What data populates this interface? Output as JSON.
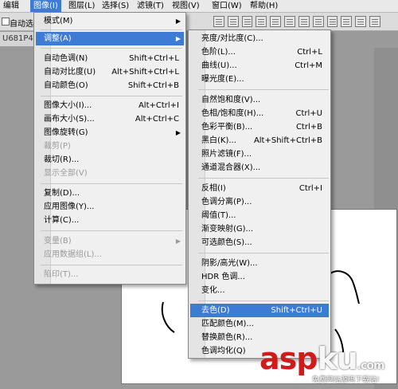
{
  "menubar": {
    "items": [
      "编辑",
      "图像(I)",
      "图层(L)",
      "选择(S)",
      "滤镜(T)",
      "视图(V)",
      "窗口(W)",
      "帮助(H)"
    ]
  },
  "options_bar": {
    "auto_select_label": "自动选"
  },
  "doc_tab": {
    "label": "U681P4"
  },
  "image_menu": {
    "items": [
      {
        "label": "模式(M)",
        "shortcut": "",
        "submenu": true,
        "state": "normal"
      },
      {
        "label": "调整(A)",
        "shortcut": "",
        "submenu": true,
        "state": "highlighted"
      },
      {
        "label": "自动色调(N)",
        "shortcut": "Shift+Ctrl+L",
        "submenu": false,
        "state": "normal"
      },
      {
        "label": "自动对比度(U)",
        "shortcut": "Alt+Shift+Ctrl+L",
        "submenu": false,
        "state": "normal"
      },
      {
        "label": "自动颜色(O)",
        "shortcut": "Shift+Ctrl+B",
        "submenu": false,
        "state": "normal"
      },
      {
        "label": "图像大小(I)...",
        "shortcut": "Alt+Ctrl+I",
        "submenu": false,
        "state": "normal"
      },
      {
        "label": "画布大小(S)...",
        "shortcut": "Alt+Ctrl+C",
        "submenu": false,
        "state": "normal"
      },
      {
        "label": "图像旋转(G)",
        "shortcut": "",
        "submenu": true,
        "state": "normal"
      },
      {
        "label": "裁剪(P)",
        "shortcut": "",
        "submenu": false,
        "state": "disabled"
      },
      {
        "label": "裁切(R)...",
        "shortcut": "",
        "submenu": false,
        "state": "normal"
      },
      {
        "label": "显示全部(V)",
        "shortcut": "",
        "submenu": false,
        "state": "disabled"
      },
      {
        "label": "复制(D)...",
        "shortcut": "",
        "submenu": false,
        "state": "normal"
      },
      {
        "label": "应用图像(Y)...",
        "shortcut": "",
        "submenu": false,
        "state": "normal"
      },
      {
        "label": "计算(C)...",
        "shortcut": "",
        "submenu": false,
        "state": "normal"
      },
      {
        "label": "变量(B)",
        "shortcut": "",
        "submenu": true,
        "state": "disabled"
      },
      {
        "label": "应用数据组(L)...",
        "shortcut": "",
        "submenu": false,
        "state": "disabled"
      },
      {
        "label": "陷印(T)...",
        "shortcut": "",
        "submenu": false,
        "state": "disabled"
      }
    ]
  },
  "adjust_menu": {
    "items": [
      {
        "label": "亮度/对比度(C)...",
        "shortcut": "",
        "state": "normal"
      },
      {
        "label": "色阶(L)...",
        "shortcut": "Ctrl+L",
        "state": "normal"
      },
      {
        "label": "曲线(U)...",
        "shortcut": "Ctrl+M",
        "state": "normal"
      },
      {
        "label": "曝光度(E)...",
        "shortcut": "",
        "state": "normal"
      },
      {
        "label": "自然饱和度(V)...",
        "shortcut": "",
        "state": "normal"
      },
      {
        "label": "色相/饱和度(H)...",
        "shortcut": "Ctrl+U",
        "state": "normal"
      },
      {
        "label": "色彩平衡(B)...",
        "shortcut": "Ctrl+B",
        "state": "normal"
      },
      {
        "label": "黑白(K)...",
        "shortcut": "Alt+Shift+Ctrl+B",
        "state": "normal"
      },
      {
        "label": "照片滤镜(F)...",
        "shortcut": "",
        "state": "normal"
      },
      {
        "label": "通道混合器(X)...",
        "shortcut": "",
        "state": "normal"
      },
      {
        "label": "反相(I)",
        "shortcut": "Ctrl+I",
        "state": "normal"
      },
      {
        "label": "色调分离(P)...",
        "shortcut": "",
        "state": "normal"
      },
      {
        "label": "阈值(T)...",
        "shortcut": "",
        "state": "normal"
      },
      {
        "label": "渐变映射(G)...",
        "shortcut": "",
        "state": "normal"
      },
      {
        "label": "可选颜色(S)...",
        "shortcut": "",
        "state": "normal"
      },
      {
        "label": "阴影/高光(W)...",
        "shortcut": "",
        "state": "normal"
      },
      {
        "label": "HDR 色调...",
        "shortcut": "",
        "state": "normal"
      },
      {
        "label": "变化...",
        "shortcut": "",
        "state": "normal"
      },
      {
        "label": "去色(D)",
        "shortcut": "Shift+Ctrl+U",
        "state": "highlighted"
      },
      {
        "label": "匹配颜色(M)...",
        "shortcut": "",
        "state": "normal"
      },
      {
        "label": "替换颜色(R)...",
        "shortcut": "",
        "state": "normal"
      },
      {
        "label": "色调均化(Q)",
        "shortcut": "",
        "state": "normal"
      }
    ]
  },
  "watermark": {
    "brand_red": "asp",
    "brand_white": "ku",
    "suffix": ".com",
    "subtitle": "免费网站源码下载站!"
  },
  "colors": {
    "highlight": "#3d7bd4",
    "menu_bg": "#f0f0f0",
    "workspace": "#9a9a9a",
    "brand_red": "#d11a1a"
  }
}
